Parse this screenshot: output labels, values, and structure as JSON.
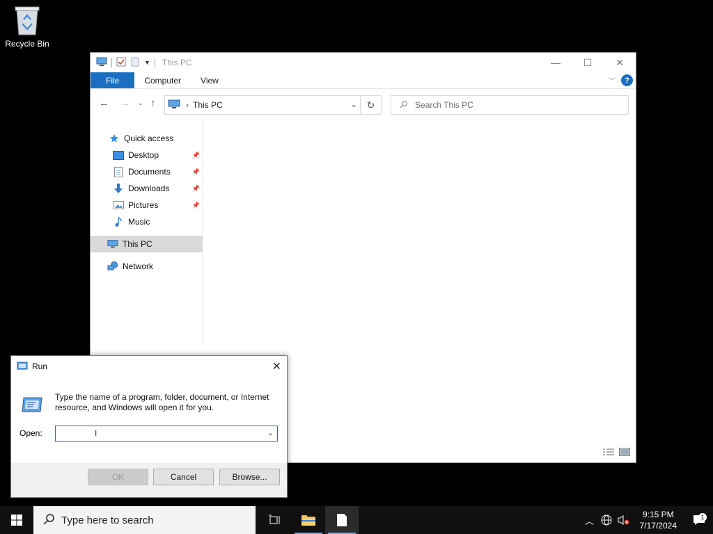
{
  "desktop": {
    "recycle_bin_label": "Recycle Bin"
  },
  "explorer": {
    "title": "This PC",
    "ribbon_tabs": [
      "File",
      "Computer",
      "View"
    ],
    "address": {
      "location": "This PC"
    },
    "search_placeholder": "Search This PC",
    "nav": {
      "quick_access": "Quick access",
      "items": [
        {
          "label": "Desktop",
          "pinned": true
        },
        {
          "label": "Documents",
          "pinned": true
        },
        {
          "label": "Downloads",
          "pinned": true
        },
        {
          "label": "Pictures",
          "pinned": true
        },
        {
          "label": "Music",
          "pinned": false
        }
      ],
      "this_pc": "This PC",
      "network": "Network"
    }
  },
  "run": {
    "title": "Run",
    "description": "Type the name of a program, folder, document, or Internet resource, and Windows will open it for you.",
    "open_label": "Open:",
    "open_value": "",
    "buttons": {
      "ok": "OK",
      "cancel": "Cancel",
      "browse": "Browse..."
    }
  },
  "taskbar": {
    "search_placeholder": "Type here to search",
    "time": "9:15 PM",
    "date": "7/17/2024",
    "notification_count": "1"
  },
  "colors": {
    "accent": "#1a6fc2",
    "desktop_bg": "#000000",
    "taskbar_bg": "#101010"
  }
}
